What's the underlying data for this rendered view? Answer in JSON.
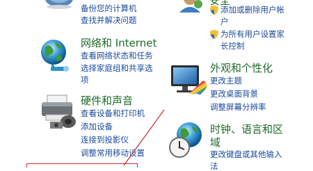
{
  "left": {
    "system": {
      "links": [
        "备份您的计算机",
        "查找并解决问题"
      ]
    },
    "network": {
      "title": "网络和 Internet",
      "links": [
        "查看网络状态和任务",
        "选择家庭组和共享选",
        "项"
      ]
    },
    "hardware": {
      "title": "硬件和声音",
      "links": [
        "查看设备和打印机",
        "添加设备",
        "连接到投影仪",
        "调整常用移动设置"
      ]
    }
  },
  "right": {
    "accounts": {
      "title_fragment": "安全",
      "links": [
        "添加或删除用户帐",
        "户",
        "为所有用户设置家",
        "长控制"
      ]
    },
    "appearance": {
      "title": "外观和个性化",
      "links": [
        "更改主题",
        "更改桌面背景",
        "调整屏幕分辨率"
      ]
    },
    "clock": {
      "title": [
        "时钟、语言和区",
        "域"
      ],
      "links": [
        "更改键盘或其他输入",
        "法"
      ]
    }
  },
  "colors": {
    "category_title": "#1d6b2a",
    "link": "#1a4a9c",
    "annotation": "#cc2a2a"
  },
  "icons": [
    "system-security-icon",
    "network-globe-icon",
    "hardware-printer-icon",
    "user-accounts-icon",
    "shield-icon",
    "appearance-monitor-icon",
    "clock-globe-icon"
  ]
}
